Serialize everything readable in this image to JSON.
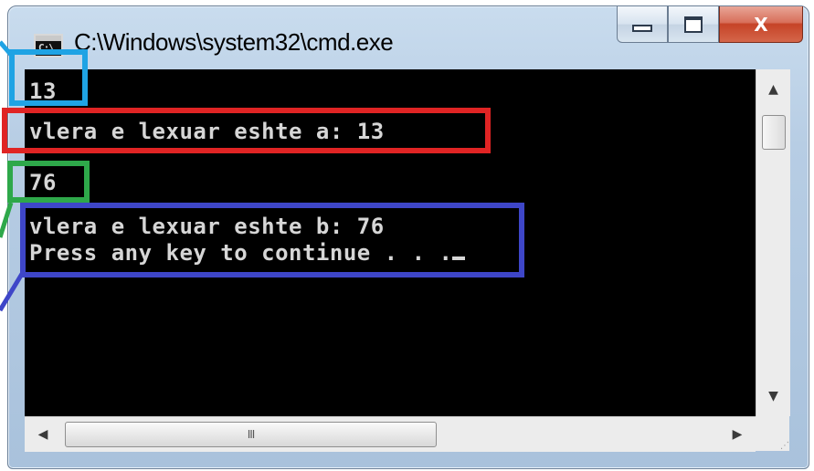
{
  "window": {
    "title": "C:\\Windows\\system32\\cmd.exe",
    "icon_name": "cmd-icon",
    "icon_text": "C:\\",
    "buttons": {
      "minimize_icon": "minimize-icon",
      "maximize_icon": "maximize-icon",
      "close_label": "X"
    }
  },
  "console": {
    "lines": [
      "13",
      "vlera e lexuar eshte a: 13",
      "76",
      "vlera e lexuar eshte b: 76",
      "Press any key to continue . . ."
    ],
    "text_color": "#d6d6d6",
    "background_color": "#000000"
  },
  "scrollbars": {
    "horizontal_thumb_grip": "III",
    "size_grip": "⋰"
  },
  "annotations": {
    "colors": {
      "input_a": "#1fa3e4",
      "output_a": "#e02424",
      "input_b": "#2ea84a",
      "output_b": "#3e46c8"
    }
  }
}
